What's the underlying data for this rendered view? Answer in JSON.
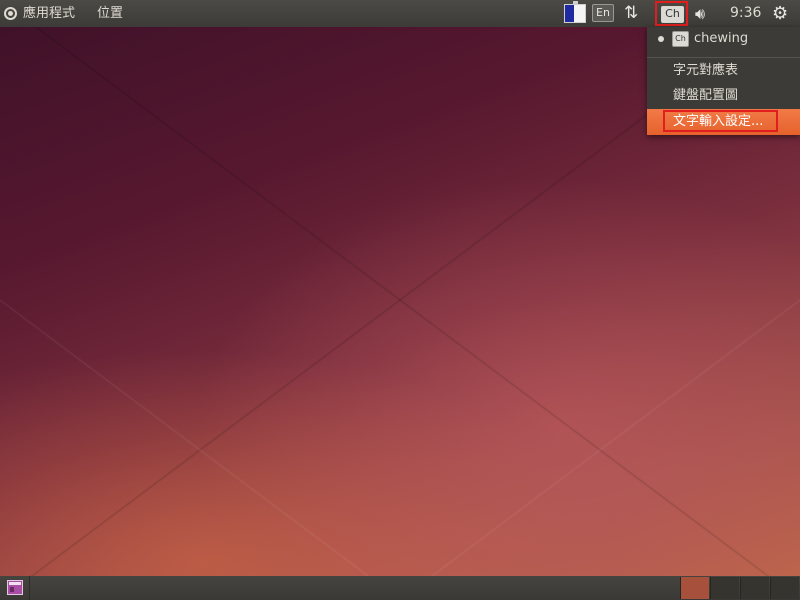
{
  "top_panel": {
    "applications_label": "應用程式",
    "places_label": "位置",
    "en_indicator_label": "En",
    "ch_indicator_label": "Ch",
    "clock": "9:36",
    "icons": {
      "applications": "ubuntu-logo-icon",
      "battery": "battery-icon",
      "network": "network-arrows-icon",
      "volume": "volume-icon",
      "power": "power-gear-icon"
    }
  },
  "indicator_menu": {
    "items": [
      {
        "label": "chewing",
        "badge": "Ch",
        "selected": true
      },
      {
        "label": "字元對應表"
      },
      {
        "label": "鍵盤配置圖"
      },
      {
        "label": "文字輸入設定...",
        "highlighted": true
      }
    ]
  },
  "bottom_panel": {
    "active_workspace": 1,
    "workspace_count": 4
  },
  "colors": {
    "panel": "#3c3b37",
    "highlight": "#e86a36",
    "annotation": "#e21d1d"
  }
}
